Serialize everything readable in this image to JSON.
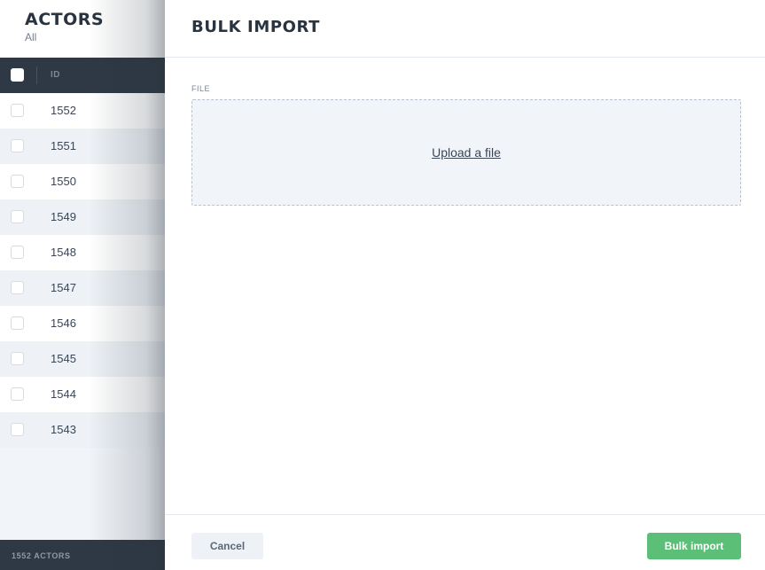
{
  "background": {
    "title": "ACTORS",
    "subtitle": "All",
    "column_id": "ID",
    "rows": [
      "1552",
      "1551",
      "1550",
      "1549",
      "1548",
      "1547",
      "1546",
      "1545",
      "1544",
      "1543"
    ],
    "footer": "1552 ACTORS"
  },
  "modal": {
    "title": "BULK IMPORT",
    "file_label": "FILE",
    "upload_link": "Upload a file",
    "cancel_label": "Cancel",
    "submit_label": "Bulk import",
    "submit_color": "#5bbf78"
  }
}
